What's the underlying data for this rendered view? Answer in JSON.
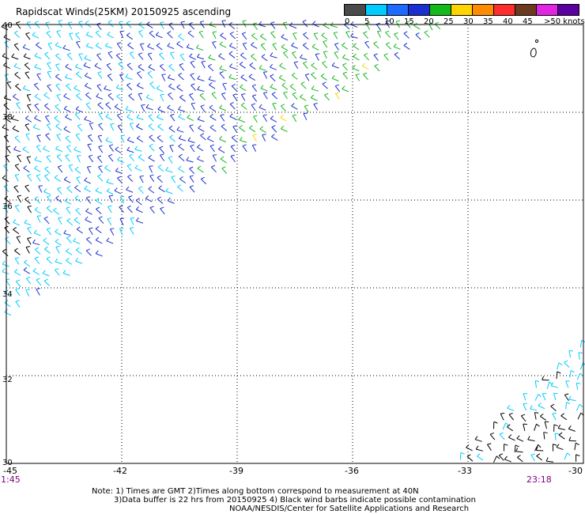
{
  "title": "Rapidscat Winds(25KM) 20150925 ascending",
  "legend": {
    "units": ">50 knots",
    "labels": [
      "0",
      "5",
      "10",
      "15",
      "20",
      "25",
      "30",
      "35",
      "40",
      "45"
    ],
    "colors": [
      "#4a4a4a",
      "#00ccff",
      "#1e6bff",
      "#1a2fd0",
      "#13b81b",
      "#ffd400",
      "#ff8c00",
      "#ff2d2d",
      "#6b3a1f",
      "#e026e0",
      "#5a00a0"
    ]
  },
  "axes": {
    "lat_labels": [
      "40",
      "38",
      "36",
      "34",
      "32",
      "30"
    ],
    "lon_labels": [
      "-45",
      "-42",
      "-39",
      "-36",
      "-33",
      "-30"
    ]
  },
  "times": {
    "left": "1:45",
    "right": "23:18"
  },
  "notes": {
    "line1": "Note: 1) Times are GMT 2)Times along bottom correspond to measurement at 40N",
    "line2": "3)Data buffer is 22 hrs from 20150925 4) Black wind barbs indicate possible contamination",
    "line3": "NOAA/NESDIS/Center for Satellite Applications and Research"
  },
  "map": {
    "lon_range": [
      -45,
      -30
    ],
    "lat_range": [
      30,
      40
    ],
    "grid": "dotted"
  },
  "colors": {
    "contaminated": "#000000",
    "light": "#00ccff",
    "moderate": "#1a2fd0",
    "fresh": "#13b81b",
    "strong": "#ffd400",
    "time_text": "#800080"
  }
}
